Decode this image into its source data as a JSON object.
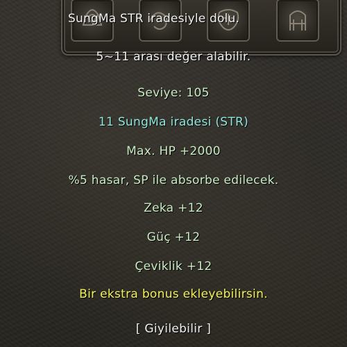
{
  "item_tooltip": {
    "socket_description": "SungMa STR iradesiyle dolu.",
    "value_range": "5~11 arası değer alabilir.",
    "level": "Seviye: 105",
    "socket_stone": "11 SungMa iradesi (STR)",
    "bonuses": [
      "Max. HP +2000",
      "%5 hasar, SP ile absorbe edilecek.",
      "Zeka +12",
      "Güç +12",
      "Çeviklik +12"
    ],
    "extra_bonus_note": "Bir ekstra bonus ekleyebilirsin.",
    "wearable": "[ Giyilebilir ]"
  },
  "colors": {
    "description": "#f0f0f0",
    "level": "#c9ecc3",
    "socket_stone": "#8fe8dc",
    "bonus": "#c9ecc3",
    "extra_bonus": "#f2f25a",
    "wearable": "#f0f0f0"
  },
  "icons": [
    "socket-slot-icon",
    "socket-slot-icon",
    "socket-slot-icon",
    "socket-slot-icon"
  ]
}
